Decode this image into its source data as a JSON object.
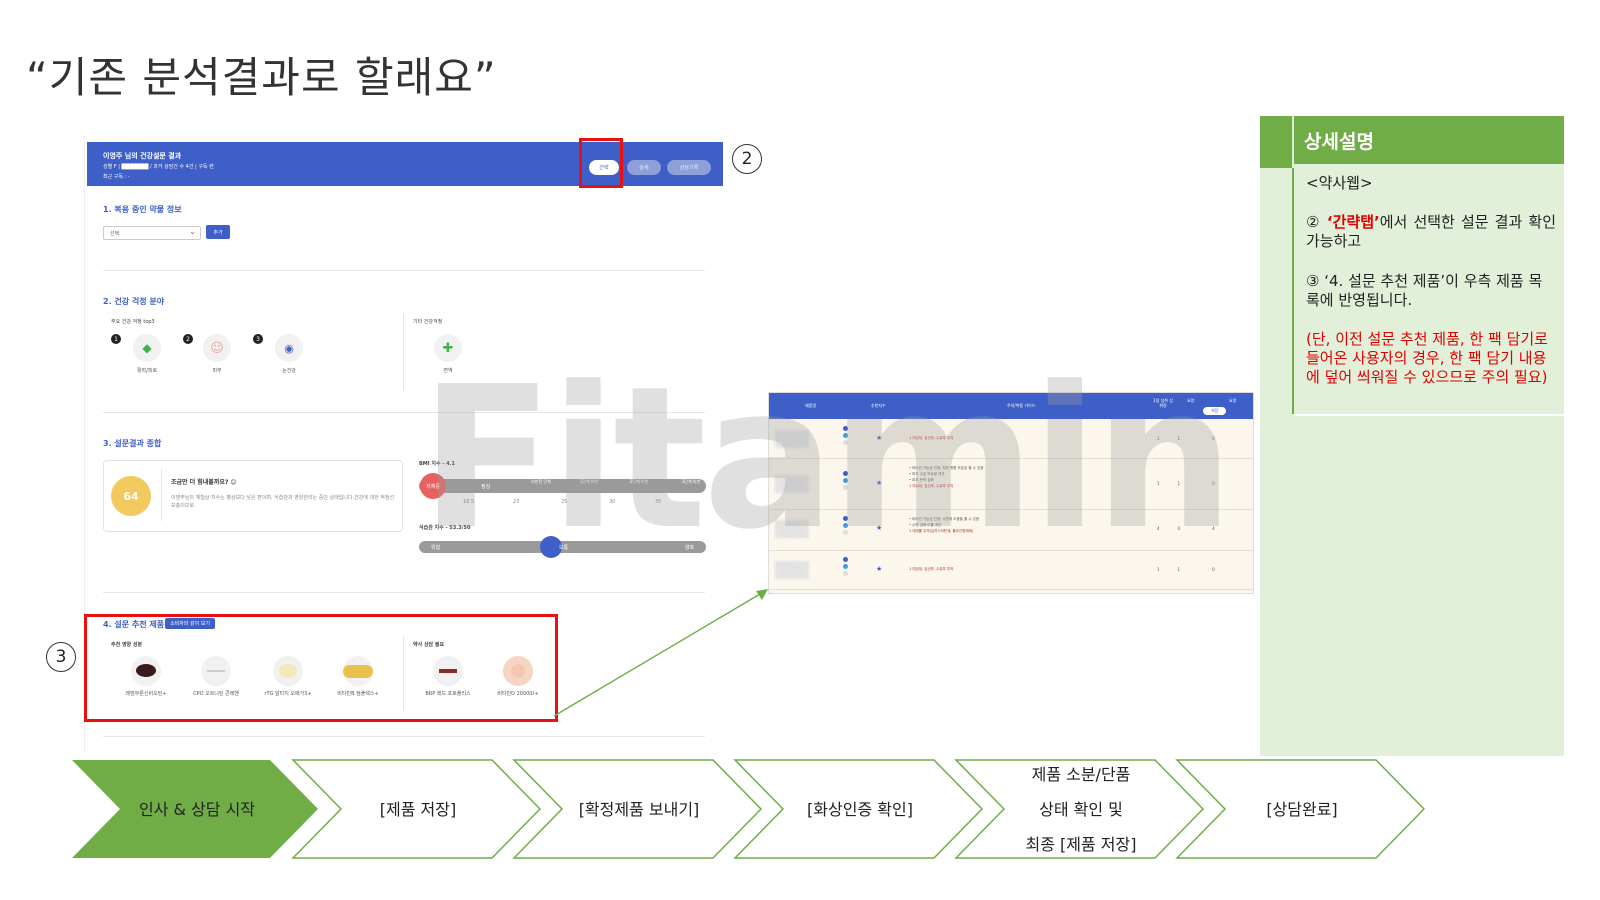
{
  "slide": {
    "title": "“기존 분석결과로 할래요”"
  },
  "screen": {
    "header": {
      "name": "이영주 님의 건강설문 결과",
      "meta": "성별 F | ███████ / 과거 상담건 수 4건 | 구독 련",
      "recent": "최근 구독 : -",
      "tabs": [
        "간략",
        "상세",
        "상담기록"
      ]
    },
    "section1": {
      "title": "1. 복용 중인 약물 정보",
      "select_value": "선택",
      "add_button": "추가"
    },
    "section2": {
      "title": "2. 건강 걱정 분야",
      "top3_label": "주요 건강 걱정 top3",
      "other_label": "기타 건강걱정",
      "top3": [
        {
          "rank": "1",
          "label": "활력/피로",
          "icon": "leaf-icon"
        },
        {
          "rank": "2",
          "label": "피부",
          "icon": "face-icon"
        },
        {
          "rank": "3",
          "label": "눈건강",
          "icon": "eye-icon"
        }
      ],
      "other": [
        {
          "label": "면역",
          "icon": "cross-icon"
        }
      ]
    },
    "section3": {
      "title": "3. 설문결과 종합",
      "score": "64",
      "score_headline": "조금만 더 힘내볼까요? 😊",
      "score_desc": "이영주님의 체험상 지수는 평상보다 낮은 편이며, 식습관과 영양관리는 중인 상태입니다.건강에 대한 적정선 보충이므로",
      "bmi_label": "BMI 지수 - 4.1",
      "bmi_value": 4.1,
      "bmi_ticks": [
        "저체중",
        "정상",
        "비만전 단계",
        "1단계 비만",
        "2단계 비만",
        "3단계 비만"
      ],
      "bmi_sub": [
        "18.5",
        "23",
        "25",
        "30",
        "35"
      ],
      "habit_label": "식습관 지수 - 53.3/50",
      "habit_ticks": [
        "위험",
        "보통",
        "양호"
      ]
    },
    "section4": {
      "title": "4. 설문 추천 제품",
      "tag": "소비자와 같이 보기",
      "nutrient_label": "추천 영양 성분",
      "consult_label": "약사 상담 필요",
      "products": [
        "레덤무론신비오틴+",
        "CPO 오르니틴 콘레헨",
        "rTG 알티지 오메가3+",
        "비타민B 컴플렉스+"
      ],
      "consult_products": [
        "BRP 레드 프로폴리스",
        "비타민D 2000IU+"
      ]
    }
  },
  "table": {
    "headers": [
      "제품명",
      "추천지수",
      "주의/복용 가이드",
      "1일 섭취 섭취량",
      "요량",
      "요량"
    ],
    "button": "저장",
    "rows": [
      {
        "guide": [
          "1 여성대, 임신부, 수유부 주의"
        ],
        "q1": "1",
        "q2": "1",
        "q3": "0"
      },
      {
        "guide": [
          "• 비타민 기능성 인정: 피부 원활 보습효 할 수 있음",
          "• 피부 수분 보유량 개선",
          "• 피부 탄력 강화",
          "1 여성대, 임신부, 수유부 주의"
        ],
        "q1": "1",
        "q2": "1",
        "q3": "0"
      },
      {
        "guide": [
          "• 비타민 기능성 인정: 수면에 도움을 줄 수 있음",
          "• 수면 강화 이를 개선",
          "1 대개를 주의(임지스타틴계, 풀무신명제제)"
        ],
        "q1": "4",
        "q2": "0",
        "q3": "4"
      },
      {
        "guide": [
          "1 여성대, 임신부, 수유부 주의"
        ],
        "q1": "1",
        "q2": "1",
        "q3": "0"
      }
    ]
  },
  "callouts": {
    "two": "2",
    "three": "3"
  },
  "watermark": "Fitamin",
  "panel": {
    "title": "상세설명",
    "web_label": "<약사웹>",
    "p2_prefix": "② ",
    "p2_highlight": "‘간략탭’",
    "p2_rest": "에서 선택한 설문 결과 확인 가능하고",
    "p3": "③ ‘4. 설문 추천 제품’이 우측 제품 목록에 반영됩니다.",
    "note": "(단, 이전 설문 추천 제품, 한 팩 담기로 들어온 사용자의 경우, 한 팩 담기 내용에 덮어 씌워질 수 있으므로 주의 필요)"
  },
  "flow": {
    "steps": [
      "인사 & 상담 시작",
      "[제품 저장]",
      "[확정제품 보내기]",
      "[화상인증 확인]",
      "제품 소분/단품\n상태 확인 및\n최종 [제품 저장]",
      "[상담완료]"
    ],
    "active_color": "#70ad47",
    "outline_color": "#70ad47"
  },
  "colors": {
    "accent": "#3e5fc7",
    "highlight_red": "#e81010",
    "panel_green": "#70ad47",
    "panel_light": "#e2f0d9"
  }
}
